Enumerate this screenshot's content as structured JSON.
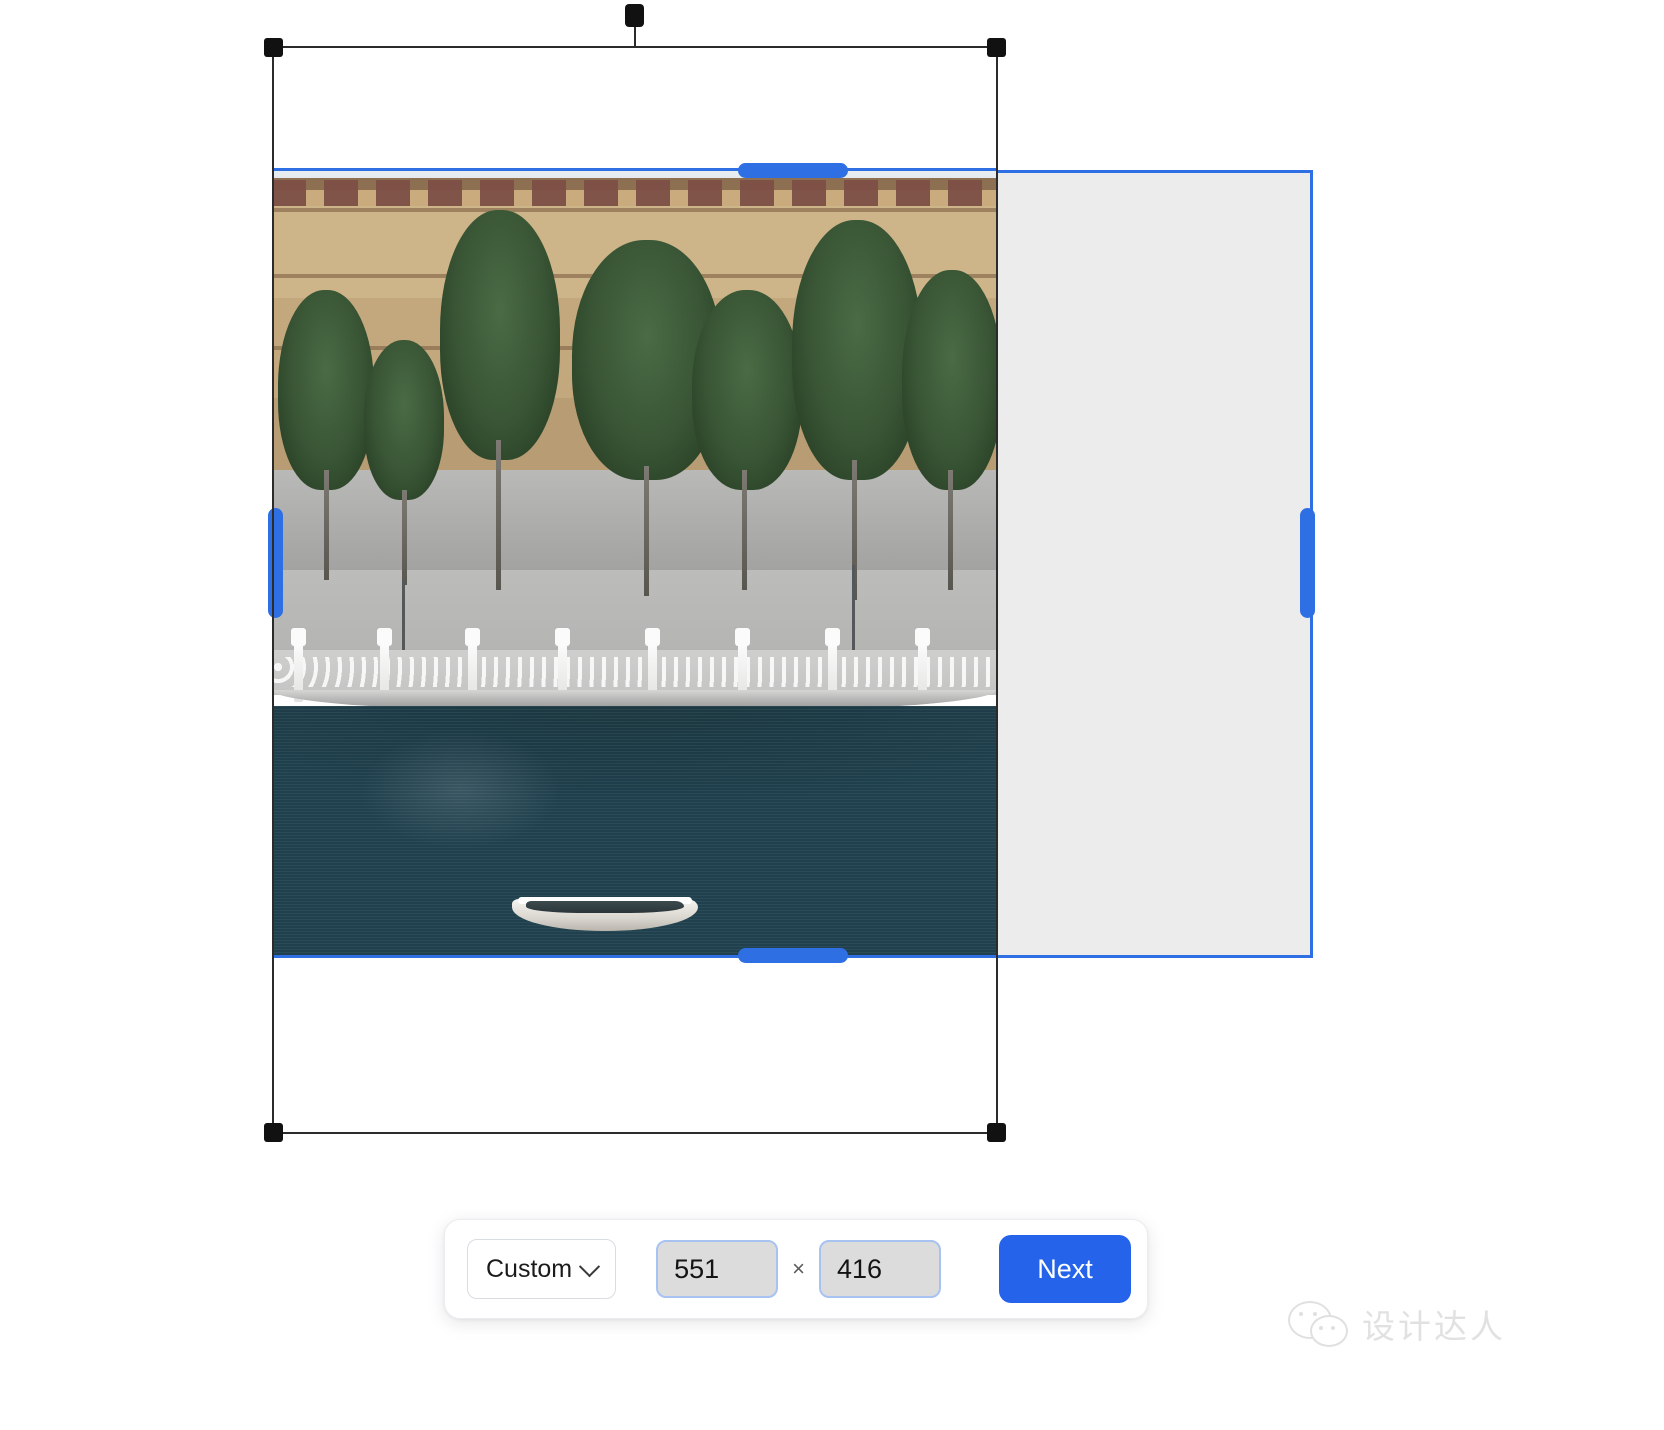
{
  "app": {
    "title": "Image Crop / Resize Editor"
  },
  "canvas": {
    "selection_frame": {
      "name": "transform-frame"
    },
    "crop_rectangle": {
      "fill_color": "#ececec",
      "border_color": "#2f6fe4"
    },
    "handle_color": "#2f6fe4",
    "frame_color": "#2b2b2b",
    "photo": {
      "alt": "Boat on dark teal pond in front of a stone fortress wall with pine trees and a chain railing"
    }
  },
  "toolbar": {
    "preset_label": "Custom",
    "preset_icon": "chevron-down-icon",
    "width_value": "551",
    "width_placeholder": "Width",
    "separator": "×",
    "height_value": "416",
    "height_placeholder": "Height",
    "next_label": "Next",
    "next_color": "#2563eb"
  },
  "watermark": {
    "icon": "wechat-icon",
    "text": "设计达人"
  }
}
